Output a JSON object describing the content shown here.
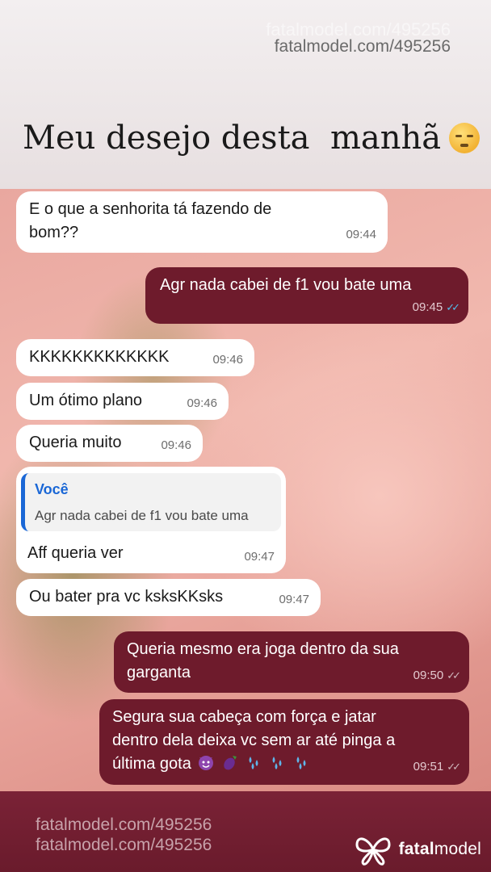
{
  "watermark": {
    "top_ghost": "fatalmodel.com/495256",
    "top": "fatalmodel.com/495256",
    "bottom_1": "fatalmodel.com/495256",
    "bottom_2": "fatalmodel.com/495256"
  },
  "headline": {
    "text": "Meu desejo desta  manhã",
    "emoji": "sleepy-face"
  },
  "messages": [
    {
      "direction": "incoming",
      "lines": [
        "E o que a senhorita tá fazendo de",
        "bom??"
      ],
      "time": "09:44"
    },
    {
      "direction": "outgoing",
      "lines": [
        "Agr nada cabei de f1 vou bate uma"
      ],
      "time": "09:45",
      "status": "read"
    },
    {
      "direction": "incoming",
      "lines": [
        "KKKKKKKKKKKKK"
      ],
      "time": "09:46"
    },
    {
      "direction": "incoming",
      "lines": [
        "Um ótimo plano"
      ],
      "time": "09:46"
    },
    {
      "direction": "incoming",
      "lines": [
        "Queria muito"
      ],
      "time": "09:46"
    },
    {
      "direction": "incoming",
      "reply_to": {
        "author": "Você",
        "text": "Agr nada cabei de f1 vou bate uma"
      },
      "lines": [
        "Aff queria ver"
      ],
      "time": "09:47"
    },
    {
      "direction": "incoming",
      "lines": [
        "Ou bater pra vc ksksKKsks"
      ],
      "time": "09:47"
    },
    {
      "direction": "outgoing",
      "lines": [
        "Queria mesmo era joga dentro da sua",
        "garganta"
      ],
      "time": "09:50",
      "status": "delivered"
    },
    {
      "direction": "outgoing",
      "lines": [
        "Segura sua cabeça com força e jatar",
        "dentro dela deixa vc sem ar até pinga a",
        "última gota"
      ],
      "emojis": [
        "devil",
        "eggplant",
        "sweat-drops",
        "sweat-drops",
        "sweat-drops"
      ],
      "time": "09:51",
      "status": "delivered"
    }
  ],
  "brand": {
    "name_bold": "fatal",
    "name_regular": "model",
    "logo_icon": "butterfly-logo-icon"
  },
  "colors": {
    "incoming_bubble": "#ffffff",
    "outgoing_bubble": "#6e1b2c",
    "read_ticks": "#53bdeb",
    "quote_accent": "#1a67d6"
  }
}
